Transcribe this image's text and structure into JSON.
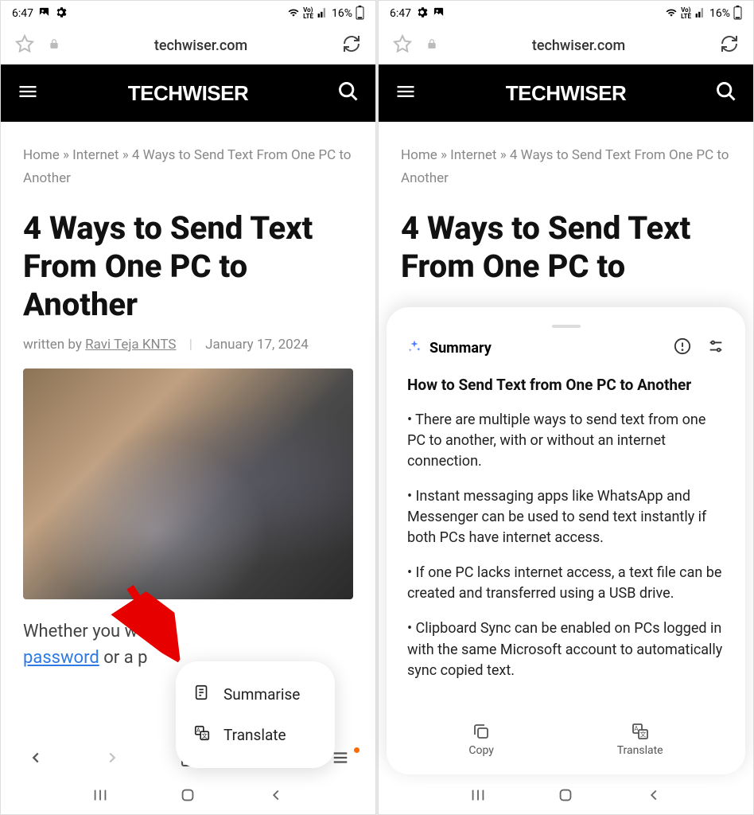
{
  "statusbar": {
    "time": "6:47",
    "battery": "16%",
    "volte": "VoLTE"
  },
  "browser": {
    "url": "techwiser.com"
  },
  "header": {
    "brand": "TECHWISER"
  },
  "breadcrumb": {
    "items": [
      "Home",
      "Internet",
      "4 Ways to Send Text From One PC to Another"
    ],
    "sep": " » "
  },
  "article": {
    "title": "4 Ways to Send Text From One PC to Another",
    "written_by": "written by ",
    "author": "Ravi Teja KNTS",
    "date": "January 17, 2024",
    "body_prefix": "Whether you wa",
    "body_link": "password",
    "body_suffix": " or a p"
  },
  "popup": {
    "summarise": "Summarise",
    "translate": "Translate"
  },
  "summary": {
    "label": "Summary",
    "title": "How to Send Text from One PC to Another",
    "points": [
      "• There are multiple ways to send text from one PC to another, with or without an internet connection.",
      "• Instant messaging apps like WhatsApp and Messenger can be used to send text instantly if both PCs have internet access.",
      "• If one PC lacks internet access, a text file can be created and transferred using a USB drive.",
      "• Clipboard Sync can be enabled on PCs logged in with the same Microsoft account to automatically sync copied text."
    ],
    "copy": "Copy",
    "translate": "Translate"
  }
}
